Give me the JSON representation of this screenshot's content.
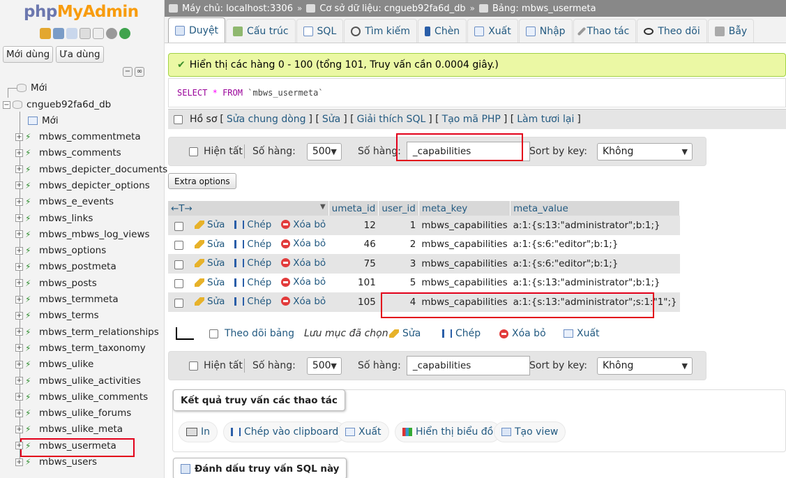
{
  "sidebar": {
    "logo_php": "php",
    "logo_myadmin": "MyAdmin",
    "tab_recent": "Mới dùng",
    "tab_favorites": "Ưa dùng",
    "new_root": "Mới",
    "database": "cngueb92fa6d_db",
    "new_table": "Mới",
    "tables": [
      "mbws_commentmeta",
      "mbws_comments",
      "mbws_depicter_documents",
      "mbws_depicter_options",
      "mbws_e_events",
      "mbws_links",
      "mbws_mbws_log_views",
      "mbws_options",
      "mbws_postmeta",
      "mbws_posts",
      "mbws_termmeta",
      "mbws_terms",
      "mbws_term_relationships",
      "mbws_term_taxonomy",
      "mbws_ulike",
      "mbws_ulike_activities",
      "mbws_ulike_comments",
      "mbws_ulike_forums",
      "mbws_ulike_meta",
      "mbws_usermeta",
      "mbws_users"
    ]
  },
  "breadcrumb": {
    "server": "Máy chủ: localhost:3306",
    "database": "Cơ sở dữ liệu: cngueb92fa6d_db",
    "table": "Bảng: mbws_usermeta"
  },
  "tabs": [
    "Duyệt",
    "Cấu trúc",
    "SQL",
    "Tìm kiếm",
    "Chèn",
    "Xuất",
    "Nhập",
    "Thao tác",
    "Theo dõi",
    "Bẫy"
  ],
  "success_message": "Hiển thị các hàng 0 - 100 (tổng 101, Truy vấn cần 0.0004 giây.)",
  "sql": {
    "select": "SELECT",
    "star": "*",
    "from": "FROM",
    "table": "`mbws_usermeta`"
  },
  "profiling": {
    "label": "Hồ sơ",
    "links": [
      "Sửa chung dòng",
      "Sửa",
      "Giải thích SQL",
      "Tạo mã PHP",
      "Làm tươi lại"
    ]
  },
  "nav": {
    "show_all": "Hiện tất",
    "rows_label": "Số hàng:",
    "rows_value": "500",
    "filter_label": "Số hàng:",
    "filter_value": "_capabilities",
    "sort_label": "Sort by key:",
    "sort_value": "Không"
  },
  "extra_options": "Extra options",
  "table": {
    "columns": [
      "umeta_id",
      "user_id",
      "meta_key",
      "meta_value"
    ],
    "actions": {
      "edit": "Sửa",
      "copy": "Chép",
      "delete": "Xóa bỏ"
    },
    "rows": [
      {
        "umeta_id": "12",
        "user_id": "1",
        "meta_key": "mbws_capabilities",
        "meta_value": "a:1:{s:13:\"administrator\";b:1;}"
      },
      {
        "umeta_id": "46",
        "user_id": "2",
        "meta_key": "mbws_capabilities",
        "meta_value": "a:1:{s:6:\"editor\";b:1;}"
      },
      {
        "umeta_id": "75",
        "user_id": "3",
        "meta_key": "mbws_capabilities",
        "meta_value": "a:1:{s:6:\"editor\";b:1;}"
      },
      {
        "umeta_id": "101",
        "user_id": "5",
        "meta_key": "mbws_capabilities",
        "meta_value": "a:1:{s:13:\"administrator\";b:1;}"
      },
      {
        "umeta_id": "105",
        "user_id": "4",
        "meta_key": "mbws_capabilities",
        "meta_value": "a:1:{s:13:\"administrator\";s:1:\"1\";}"
      }
    ]
  },
  "bulk": {
    "check_all": "Theo dõi bảng",
    "with_selected": "Lưu mục đã chọn",
    "edit": "Sửa",
    "copy": "Chép",
    "delete": "Xóa bỏ",
    "export": "Xuất"
  },
  "query_ops": {
    "legend": "Kết quả truy vấn các thao tác",
    "print": "In",
    "clipboard": "Chép vào clipboard",
    "export": "Xuất",
    "chart": "Hiển thị biểu đồ",
    "view": "Tạo view"
  },
  "bookmark": "Đánh dấu truy vấn SQL này",
  "colors": {
    "highlight": "#e2001a",
    "link": "#235a81",
    "success_bg": "#ebf8a4"
  }
}
